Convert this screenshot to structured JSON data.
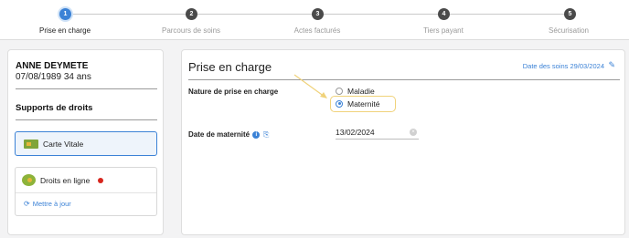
{
  "stepper": {
    "steps": [
      {
        "number": "1",
        "label": "Prise en charge",
        "active": true
      },
      {
        "number": "2",
        "label": "Parcours de soins",
        "active": false
      },
      {
        "number": "3",
        "label": "Actes facturés",
        "active": false
      },
      {
        "number": "4",
        "label": "Tiers payant",
        "active": false
      },
      {
        "number": "5",
        "label": "Sécurisation",
        "active": false
      }
    ]
  },
  "patient": {
    "name": "ANNE DEYMETE",
    "dob_age": "07/08/1989 34 ans"
  },
  "supports": {
    "title": "Supports de droits",
    "carte_vitale": "Carte Vitale",
    "droits_en_ligne": "Droits en ligne",
    "mettre_a_jour": "Mettre à jour"
  },
  "main": {
    "title": "Prise en charge",
    "date_soins": "Date des soins 29/03/2024",
    "nature_label": "Nature de prise en charge",
    "options": [
      {
        "label": "Maladie",
        "checked": false
      },
      {
        "label": "Maternité",
        "checked": true
      }
    ],
    "date_maternite_label": "Date de maternité",
    "date_maternite_value": "13/02/2024"
  },
  "colors": {
    "accent": "#3b82d6",
    "highlight": "#f0d27a",
    "alert_dot": "#d7261e"
  },
  "icons": {
    "edit": "pencil-icon",
    "refresh": "refresh-icon",
    "info": "info-icon",
    "card": "card-reader-icon",
    "clear": "clear-icon"
  }
}
